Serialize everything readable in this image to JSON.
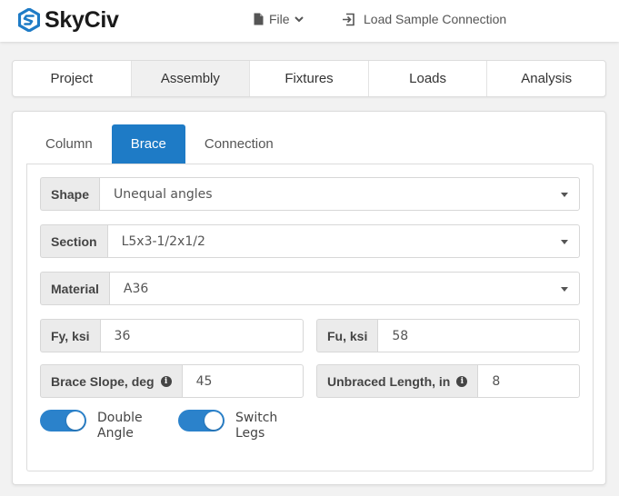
{
  "brand": {
    "name": "SkyCiv",
    "color": "#1e7bc6"
  },
  "header": {
    "file_label": "File",
    "load_sample_label": "Load Sample Connection"
  },
  "main_tabs": [
    {
      "label": "Project",
      "active": false
    },
    {
      "label": "Assembly",
      "active": true
    },
    {
      "label": "Fixtures",
      "active": false
    },
    {
      "label": "Loads",
      "active": false
    },
    {
      "label": "Analysis",
      "active": false
    }
  ],
  "sub_tabs": [
    {
      "label": "Column",
      "active": false
    },
    {
      "label": "Brace",
      "active": true
    },
    {
      "label": "Connection",
      "active": false
    }
  ],
  "form": {
    "shape": {
      "label": "Shape",
      "value": "Unequal angles"
    },
    "section": {
      "label": "Section",
      "value": "L5x3-1/2x1/2"
    },
    "material": {
      "label": "Material",
      "value": "A36"
    },
    "fy": {
      "label": "Fy, ksi",
      "value": "36"
    },
    "fu": {
      "label": "Fu, ksi",
      "value": "58"
    },
    "brace_slope": {
      "label": "Brace Slope, deg",
      "value": "45"
    },
    "unbraced_length": {
      "label": "Unbraced Length, in",
      "value": "8"
    },
    "double_angle": {
      "label": "Double Angle",
      "on": true
    },
    "switch_legs": {
      "label": "Switch Legs",
      "on": true
    }
  },
  "colors": {
    "accent": "#1e7bc6",
    "toggle_on": "#2b82cb"
  }
}
